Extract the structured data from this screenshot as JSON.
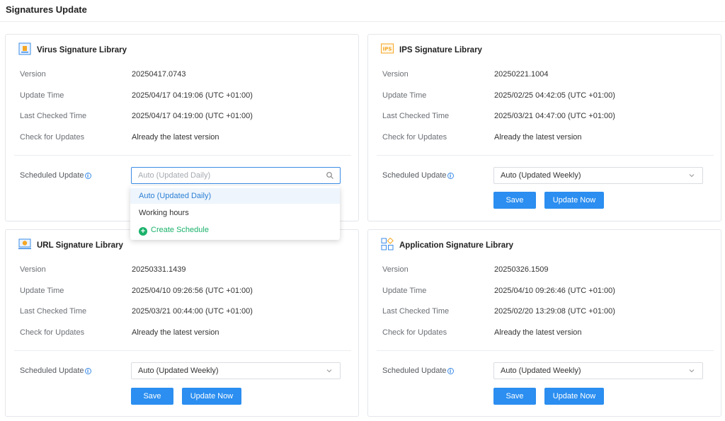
{
  "page": {
    "title": "Signatures Update"
  },
  "labels": {
    "version": "Version",
    "update_time": "Update Time",
    "last_checked_time": "Last Checked Time",
    "check_for_updates": "Check for Updates",
    "scheduled_update": "Scheduled Update",
    "save": "Save",
    "update_now": "Update Now"
  },
  "cards": {
    "virus": {
      "title": "Virus Signature Library",
      "version": "20250417.0743",
      "update_time": "2025/04/17 04:19:06 (UTC +01:00)",
      "last_checked_time": "2025/04/17 04:19:00 (UTC +01:00)",
      "check_for_updates": "Already the latest version",
      "scheduled_placeholder": "Auto (Updated Daily)"
    },
    "ips": {
      "title": "IPS Signature Library",
      "icon_text": "IPS",
      "version": "20250221.1004",
      "update_time": "2025/02/25 04:42:05 (UTC +01:00)",
      "last_checked_time": "2025/03/21 04:47:00 (UTC +01:00)",
      "check_for_updates": "Already the latest version",
      "scheduled_value": "Auto (Updated Weekly)"
    },
    "url": {
      "title": "URL Signature Library",
      "version": "20250331.1439",
      "update_time": "2025/04/10 09:26:56 (UTC +01:00)",
      "last_checked_time": "2025/03/21 00:44:00 (UTC +01:00)",
      "check_for_updates": "Already the latest version",
      "scheduled_value": "Auto (Updated Weekly)"
    },
    "application": {
      "title": "Application Signature Library",
      "version": "20250326.1509",
      "update_time": "2025/04/10 09:26:46 (UTC +01:00)",
      "last_checked_time": "2025/02/20 13:29:08 (UTC +01:00)",
      "check_for_updates": "Already the latest version",
      "scheduled_value": "Auto (Updated Weekly)"
    }
  },
  "dropdown": {
    "options": [
      "Auto (Updated Daily)",
      "Working hours"
    ],
    "create": "Create Schedule",
    "selected": "Auto (Updated Daily)"
  },
  "colors": {
    "primary": "#2b8ef0",
    "create": "#1bb26b",
    "icon_orange": "#f5a623"
  }
}
